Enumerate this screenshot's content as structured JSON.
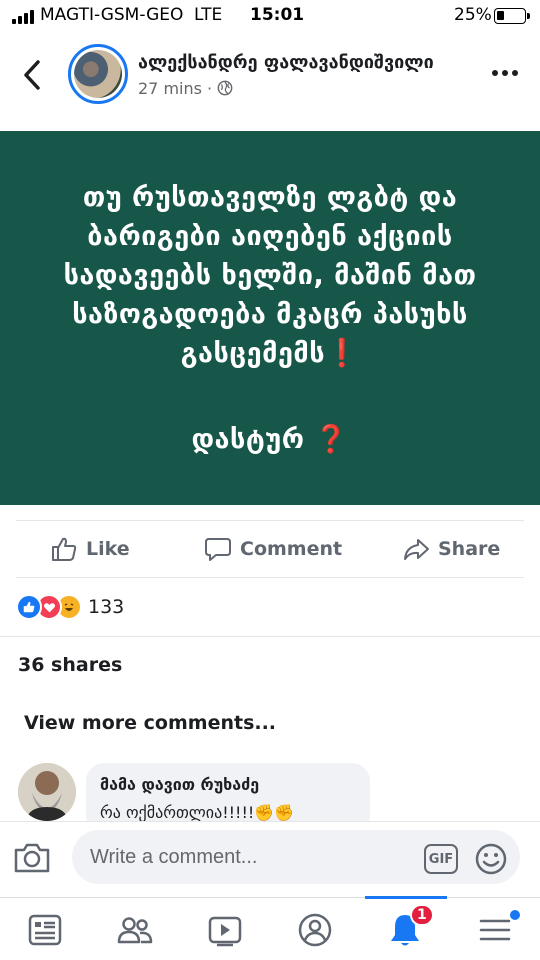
{
  "status_bar": {
    "carrier": "MAGTI-GSM-GEO",
    "network": "LTE",
    "time": "15:01",
    "battery": "25%",
    "battery_level": 0.25
  },
  "header": {
    "author": "ალექსანდრე ფალავანდიშვილი",
    "time": "27 mins",
    "separator": "·",
    "audience_icon": "globe-icon",
    "back_icon": "chevron-left-icon",
    "more_icon": "more-dots-icon"
  },
  "post": {
    "background": "#17574a",
    "lines": [
      "თუ რუსთაველზე ლგბტ და",
      "ბარიგები აიღებენ აქციის",
      "სადავეებს ხელში, მაშინ მათ",
      "საზოგადოება მკაცრ პასუხს",
      "გასცემემს"
    ],
    "closing": "დასტურ",
    "marks": {
      "exclamation": "❗",
      "question": "❓"
    }
  },
  "actions": {
    "like": "Like",
    "comment": "Comment",
    "share": "Share"
  },
  "reactions": {
    "types": [
      "like",
      "love",
      "haha"
    ],
    "count": "133"
  },
  "shares": "36 shares",
  "view_more": "View more comments...",
  "comment": {
    "name": "მამა დავით რუხაძე",
    "text": "რა ოქმართლია!!!!!✊✊"
  },
  "composer": {
    "placeholder": "Write a comment...",
    "gif_label": "GIF"
  },
  "bottom_nav": {
    "items": [
      "news-feed-icon",
      "friends-icon",
      "watch-icon",
      "profile-icon",
      "notifications-icon",
      "menu-icon"
    ],
    "active": "notifications-icon",
    "notification_badge": "1"
  },
  "colors": {
    "accent": "#1877f2",
    "post_bg": "#17574a",
    "badge": "#e41e3f"
  }
}
